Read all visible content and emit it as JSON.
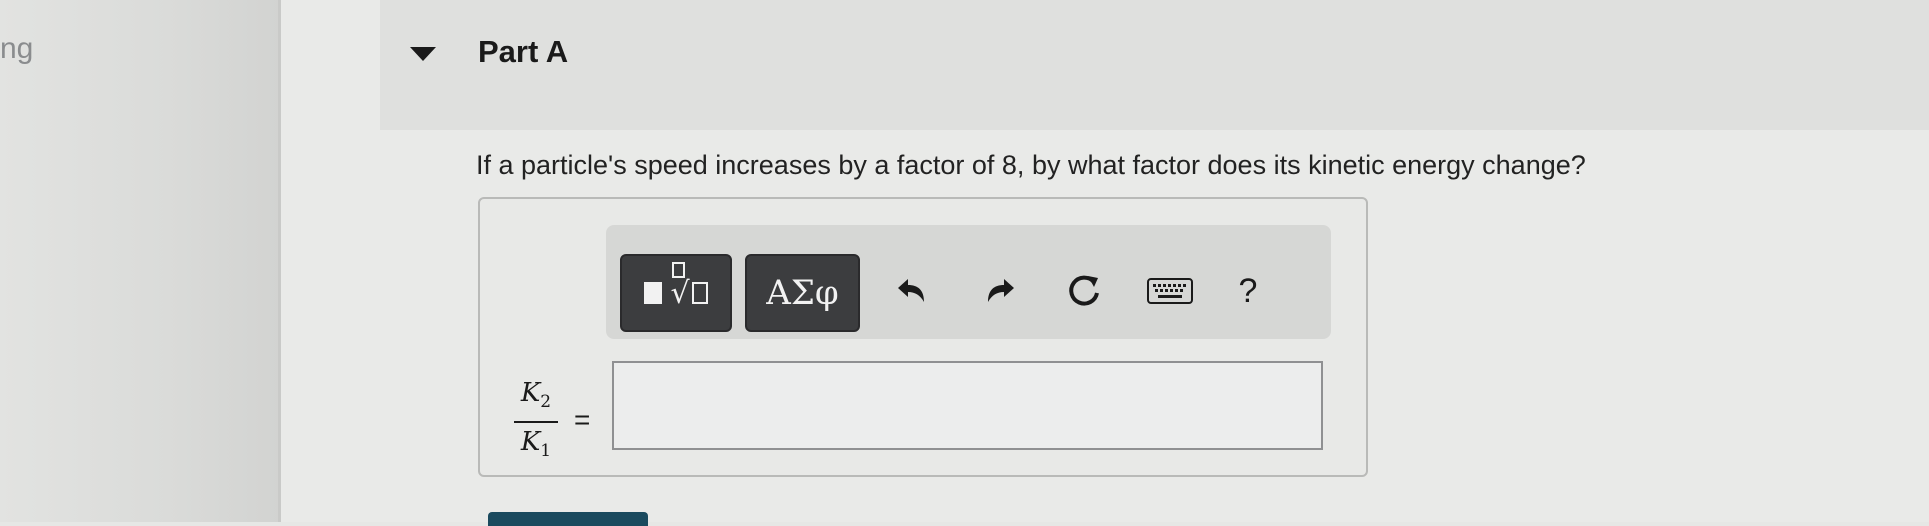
{
  "left_nav": {
    "text": "ng"
  },
  "part": {
    "title": "Part A",
    "expanded_icon": "caret-down-icon"
  },
  "question": {
    "text": "If a particle's speed increases by a factor of 8, by what factor does its kinetic energy change?"
  },
  "toolbar": {
    "templates_icon": "templates-radical-icon",
    "symbols_label": "ΑΣφ",
    "undo_icon": "undo-icon",
    "redo_icon": "redo-icon",
    "reset_icon": "reset-icon",
    "keyboard_icon": "keyboard-icon",
    "help_label": "?"
  },
  "answer": {
    "numerator": "K",
    "numerator_sub": "2",
    "denominator": "K",
    "denominator_sub": "1",
    "equals": "=",
    "value": ""
  },
  "colors": {
    "background": "#e9eae8",
    "toolbar_button": "#3c3d3f",
    "submit_button": "#1a4a5e"
  }
}
